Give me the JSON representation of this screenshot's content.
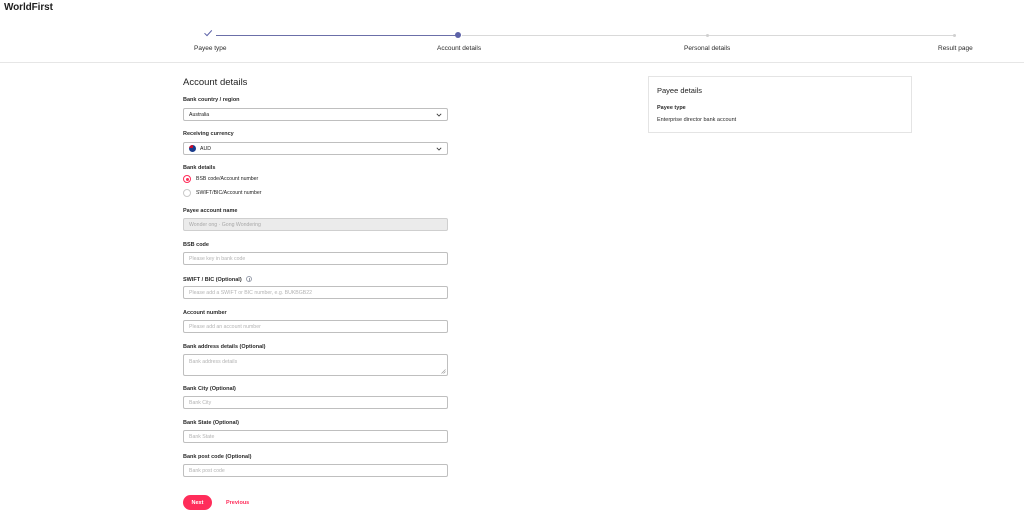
{
  "brand": {
    "logo": "WorldFirst",
    "accent": "#ff2d5a",
    "stepper_accent": "#5c62a8"
  },
  "stepper": {
    "steps": [
      {
        "label": "Payee type",
        "state": "done"
      },
      {
        "label": "Account details",
        "state": "active"
      },
      {
        "label": "Personal details",
        "state": "todo"
      },
      {
        "label": "Result page",
        "state": "todo"
      }
    ]
  },
  "form": {
    "title": "Account details",
    "bank_country": {
      "label": "Bank country / region",
      "value": "Australia"
    },
    "receiving_currency": {
      "label": "Receiving currency",
      "value": "AUD",
      "icon": "australia-flag-icon"
    },
    "bank_details": {
      "label": "Bank details",
      "options": [
        {
          "label": "BSB code/Account number",
          "selected": true
        },
        {
          "label": "SWIFT/BIC/Account number",
          "selected": false
        }
      ]
    },
    "payee_account_name": {
      "label": "Payee account name",
      "value": "Wonder ong · Gong Wondering"
    },
    "bsb_code": {
      "label": "BSB code",
      "placeholder": "Please key in bank code"
    },
    "swift_bic": {
      "label": "SWIFT / BIC (Optional)",
      "placeholder": "Please add a SWIFT or BIC number, e.g. BUKBGB22"
    },
    "account_number": {
      "label": "Account number",
      "placeholder": "Please add an account number"
    },
    "bank_address": {
      "label": "Bank address details (Optional)",
      "placeholder": "Bank address details"
    },
    "bank_city": {
      "label": "Bank City (Optional)",
      "placeholder": "Bank City"
    },
    "bank_state": {
      "label": "Bank State (Optional)",
      "placeholder": "Bank State"
    },
    "bank_post_code": {
      "label": "Bank post code (Optional)",
      "placeholder": "Bank post code"
    },
    "next_label": "Next",
    "previous_label": "Previous"
  },
  "payee_card": {
    "title": "Payee details",
    "key": "Payee type",
    "value": "Enterprise director bank account"
  }
}
